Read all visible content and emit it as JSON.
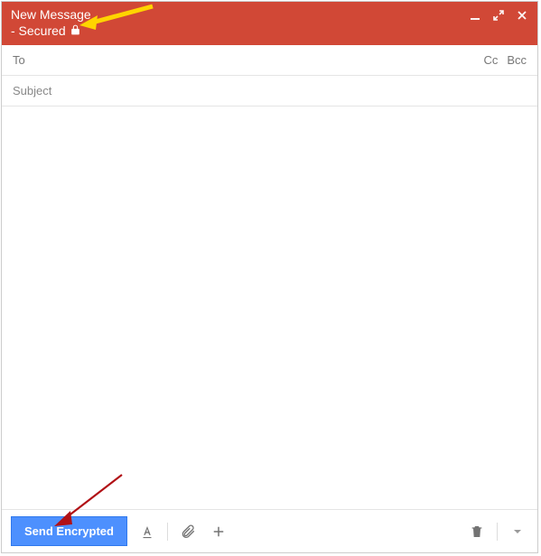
{
  "header": {
    "title": "New Message",
    "secured_label": "- Secured"
  },
  "fields": {
    "to_label": "To",
    "cc_label": "Cc",
    "bcc_label": "Bcc",
    "subject_placeholder": "Subject"
  },
  "toolbar": {
    "send_label": "Send Encrypted"
  }
}
